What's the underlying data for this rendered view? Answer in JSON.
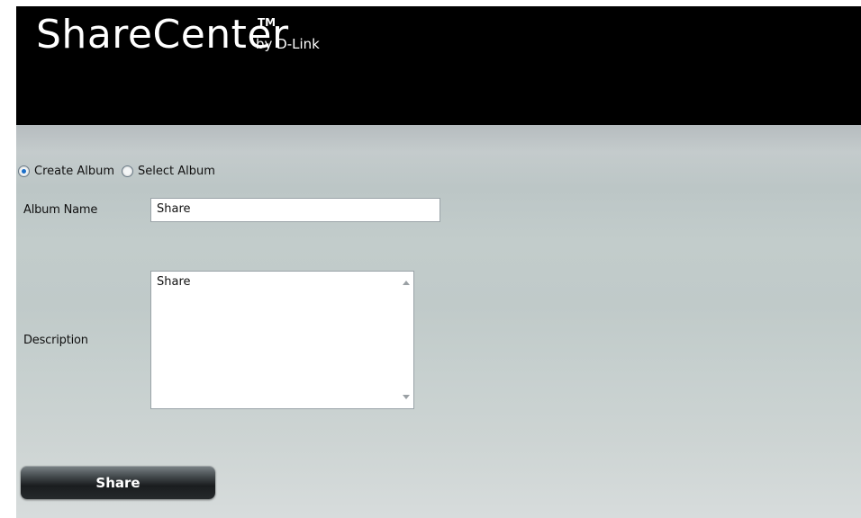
{
  "header": {
    "brand_name": "ShareCenter",
    "brand_tm": "TM",
    "brand_by": "by D-Link"
  },
  "form": {
    "mode_options": [
      {
        "label": "Create Album",
        "selected": true
      },
      {
        "label": "Select Album",
        "selected": false
      }
    ],
    "album_name_label": "Album Name",
    "album_name_value": "Share",
    "description_label": "Description",
    "description_value": "Share",
    "share_button_label": "Share"
  },
  "colors": {
    "header_bg": "#000000",
    "radio_selected": "#1c6fc9",
    "button_dark": "#1a1d1f"
  }
}
